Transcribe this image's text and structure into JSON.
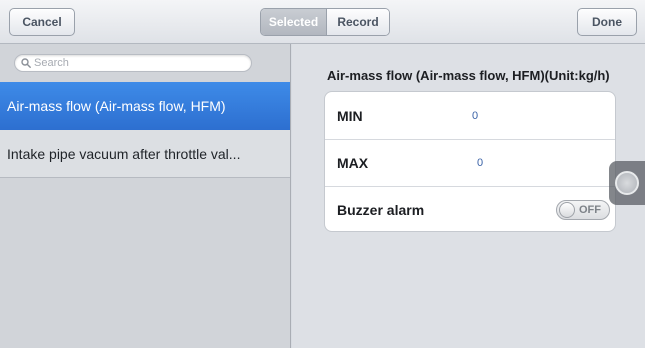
{
  "toolbar": {
    "cancel_label": "Cancel",
    "segments": [
      "Selected",
      "Record"
    ],
    "active_segment": "Selected",
    "done_label": "Done"
  },
  "sidebar": {
    "search": {
      "placeholder": "Search",
      "value": ""
    },
    "items": [
      {
        "label": "Air-mass flow (Air-mass flow, HFM)",
        "selected": true
      },
      {
        "label": "Intake pipe vacuum after throttle val...",
        "selected": false
      }
    ]
  },
  "detail": {
    "title": "Air-mass flow (Air-mass flow, HFM)(Unit:kg/h)",
    "rows": {
      "min": {
        "label": "MIN",
        "value": "0"
      },
      "max": {
        "label": "MAX",
        "value": "0"
      },
      "buzzer": {
        "label": "Buzzer alarm",
        "state": "OFF"
      }
    }
  },
  "icons": {
    "search": "search-icon",
    "toggle_knob": "toggle-knob-icon",
    "assistive": "assistive-touch-icon"
  },
  "colors": {
    "accent": "#2d6fd0",
    "value_text": "#3a62a7",
    "background": "#d7dbe1"
  }
}
